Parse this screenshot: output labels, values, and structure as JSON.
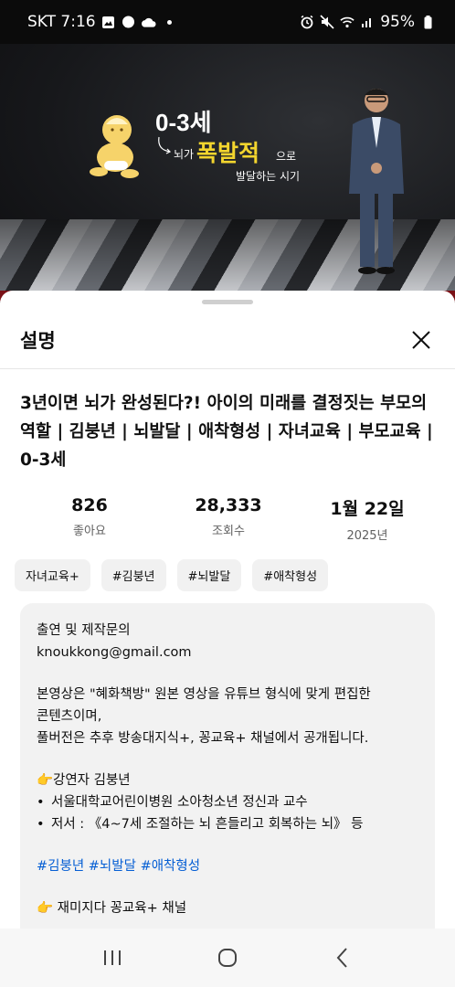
{
  "status_bar": {
    "carrier_time": "SKT 7:16",
    "battery": "95%",
    "icons": [
      "gallery-icon",
      "chat-icon",
      "cloud-icon",
      "dot-icon",
      "alarm-icon",
      "mute-icon",
      "wifi-icon",
      "signal-icon",
      "battery-icon"
    ]
  },
  "video": {
    "slide_title": "0-3세",
    "slide_text_1": "뇌가",
    "slide_highlight": "폭발적",
    "slide_text_2": "으로",
    "slide_text_3": "발달하는 시기"
  },
  "sheet": {
    "title": "설명",
    "video_title": "3년이면 뇌가 완성된다?! 아이의 미래를 결정짓는 부모의 역할 | 김붕년 | 뇌발달 | 애착형성 | 자녀교육 | 부모교육 | 0-3세",
    "stats": [
      {
        "value": "826",
        "label": "좋아요"
      },
      {
        "value": "28,333",
        "label": "조회수"
      },
      {
        "value": "1월 22일",
        "label": "2025년"
      }
    ],
    "chips": [
      "자녀교육+",
      "#김붕년",
      "#뇌발달",
      "#애착형성"
    ],
    "description": {
      "contact_title": "출연 및 제작문의",
      "email": "knoukkong@gmail.com",
      "para1_line1": "본영상은 \"혜화책방\"  원본 영상을 유튜브 형식에 맞게 편집한",
      "para1_line2": "콘텐츠이며,",
      "para1_line3": "풀버전은 추후 방송대지식+, 꽁교육+ 채널에서 공개됩니다.",
      "lecturer_label": "강연자 김붕년",
      "bullet1": "서울대학교어린이병원 소아청소년 정신과 교수",
      "bullet2": "저서 : 《4~7세 조절하는 뇌 흔들리고 회복하는 뇌》 등",
      "hashtags": [
        "#김붕년",
        "#뇌발달",
        "#애착형성"
      ],
      "channel_label": "재미지다 꽁교육+ 채널"
    }
  },
  "colors": {
    "link": "#065fd4",
    "highlight_yellow": "#f3d52e",
    "box_bg": "#f2f2f2"
  }
}
